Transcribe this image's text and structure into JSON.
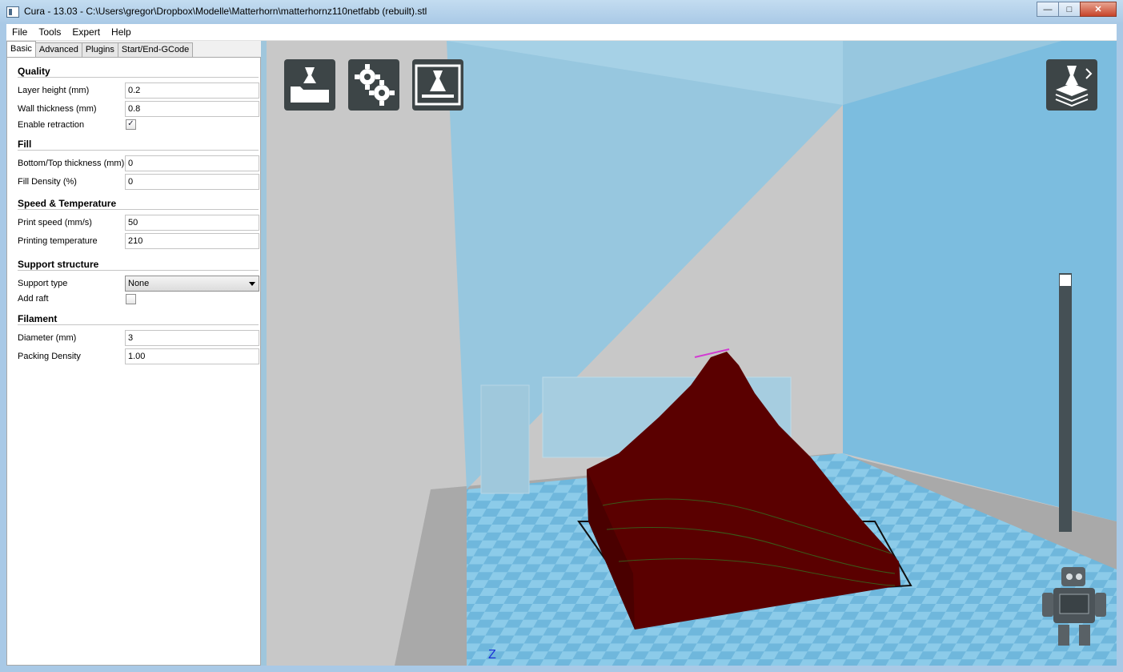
{
  "window": {
    "title": "Cura - 13.03 - C:\\Users\\gregor\\Dropbox\\Modelle\\Matterhorn\\matterhornz110netfabb (rebuilt).stl",
    "minimize_glyph": "—",
    "maximize_glyph": "□",
    "close_glyph": "✕"
  },
  "menu": [
    "File",
    "Tools",
    "Expert",
    "Help"
  ],
  "tabs": [
    "Basic",
    "Advanced",
    "Plugins",
    "Start/End-GCode"
  ],
  "settings": {
    "quality": {
      "heading": "Quality",
      "layer_height_label": "Layer height (mm)",
      "layer_height_value": "0.2",
      "wall_thickness_label": "Wall thickness (mm)",
      "wall_thickness_value": "0.8",
      "retraction_label": "Enable retraction",
      "retraction_checked": true,
      "check_glyph": "✓"
    },
    "fill": {
      "heading": "Fill",
      "bottom_top_label": "Bottom/Top thickness (mm)",
      "bottom_top_value": "0",
      "density_label": "Fill Density (%)",
      "density_value": "0"
    },
    "speed": {
      "heading": "Speed & Temperature",
      "print_speed_label": "Print speed (mm/s)",
      "print_speed_value": "50",
      "temp_label": "Printing temperature",
      "temp_value": "210"
    },
    "support": {
      "heading": "Support structure",
      "type_label": "Support type",
      "type_value": "None",
      "raft_label": "Add raft",
      "raft_checked": false
    },
    "filament": {
      "heading": "Filament",
      "diameter_label": "Diameter (mm)",
      "diameter_value": "3",
      "packing_label": "Packing Density",
      "packing_value": "1.00"
    }
  },
  "viewport": {
    "tool_icons": [
      "load-model-icon",
      "settings-gears-icon",
      "print-gcode-icon",
      "view-mode-icon"
    ],
    "axis_label": "Z",
    "layer_slider_position": 1.0,
    "colors": {
      "build_volume": "#7fc0df",
      "platform": "#6cb3d9",
      "model": "#5a0000",
      "tool_button": "#3d4547"
    }
  }
}
